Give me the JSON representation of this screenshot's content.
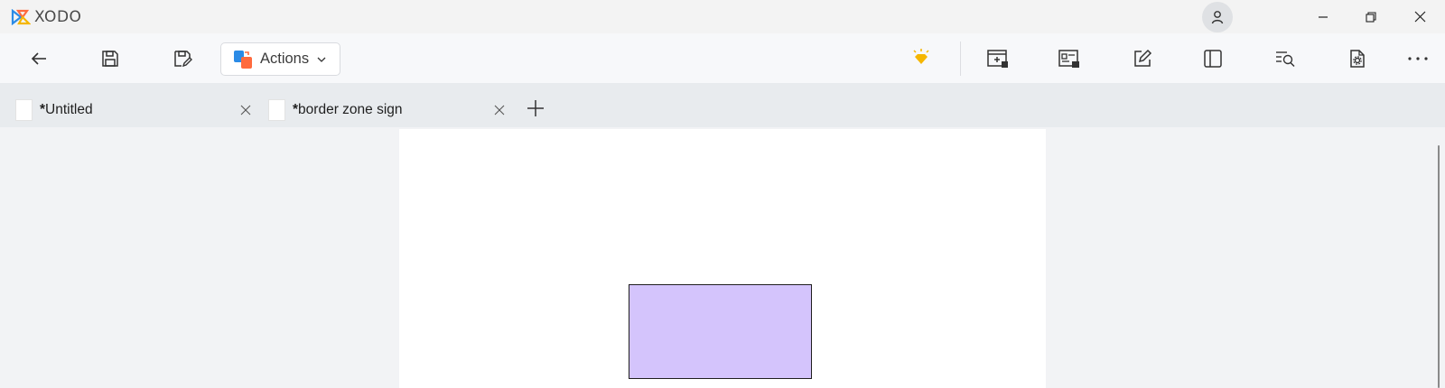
{
  "app": {
    "name": "XODO"
  },
  "toolbar": {
    "actions_label": "Actions"
  },
  "tabs": [
    {
      "modified_mark": "*",
      "label": "Untitled"
    },
    {
      "modified_mark": "*",
      "label": "border zone sign"
    }
  ],
  "document": {
    "shape_fill": "#d4c4fc",
    "shape_stroke": "#1e1e1e"
  },
  "colors": {
    "accent_blue": "#2b8be6",
    "accent_orange": "#ff6a3d",
    "premium_yellow": "#f5b600"
  },
  "icons": [
    "back-arrow-icon",
    "save-icon",
    "save-as-icon",
    "actions-app-icon",
    "chevron-down-icon",
    "premium-diamond-icon",
    "add-page-icon",
    "protect-document-icon",
    "edit-icon",
    "sidebar-panel-icon",
    "search-text-icon",
    "document-settings-icon",
    "more-icon",
    "user-icon",
    "minimize-icon",
    "restore-icon",
    "close-icon",
    "plus-icon"
  ]
}
